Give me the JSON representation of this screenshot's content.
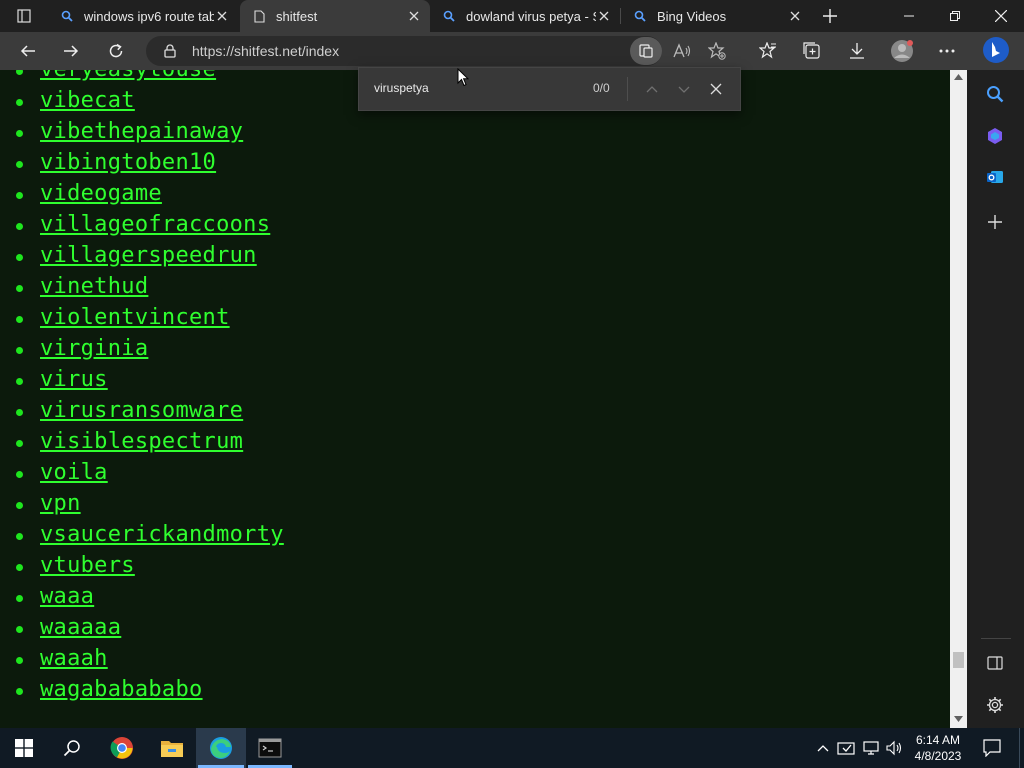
{
  "browser": {
    "tabs": [
      {
        "label": "windows ipv6 route tab",
        "icon": "search-icon",
        "active": false
      },
      {
        "label": "shitfest",
        "icon": "page-icon",
        "active": true
      },
      {
        "label": "dowland virus petya - Se",
        "icon": "search-icon",
        "active": false
      },
      {
        "label": "Bing Videos",
        "icon": "search-icon",
        "active": false
      }
    ],
    "url": "https://shitfest.net/index"
  },
  "find": {
    "query": "viruspetya",
    "count": "0/0"
  },
  "page": {
    "links": [
      "veryeasytouse",
      "vibecat",
      "vibethepainaway",
      "vibingtoben10",
      "videogame",
      "villageofraccoons",
      "villagerspeedrun",
      "vinethud",
      "violentvincent",
      "virginia",
      "virus",
      "virusransomware",
      "visiblespectrum",
      "voila",
      "vpn",
      "vsaucerickandmorty",
      "vtubers",
      "waaa",
      "waaaaa",
      "waaah",
      "wagababababo"
    ],
    "link_color": "#2fff2f",
    "background": "#0c1a0c"
  },
  "clock": {
    "time": "6:14 AM",
    "date": "4/8/2023"
  }
}
